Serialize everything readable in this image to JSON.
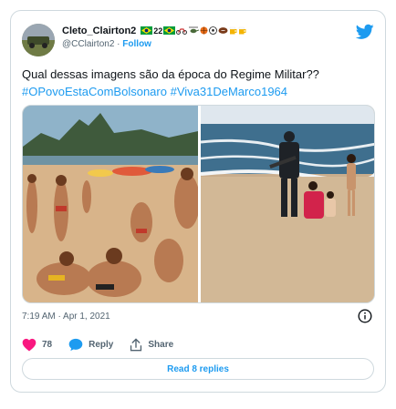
{
  "author": {
    "display_name": "Cleto_Clairton2",
    "badge_text": "22",
    "handle": "@CClairton2",
    "separator": " · ",
    "follow_label": "Follow"
  },
  "tweet": {
    "text": "Qual dessas imagens são da época do Regime Militar??",
    "hashtags": [
      "#OPovoEstaComBolsonaro",
      "#Viva31DeMarco1964"
    ]
  },
  "meta": {
    "timestamp": "7:19 AM · Apr 1, 2021"
  },
  "actions": {
    "like_count": "78",
    "reply_label": "Reply",
    "share_label": "Share"
  },
  "replies_button": "Read 8 replies",
  "icons": {
    "logo": "twitter-bird-icon",
    "like": "heart-icon",
    "reply": "speech-bubble-icon",
    "share": "share-arrow-icon",
    "info": "info-icon"
  },
  "colors": {
    "accent": "#1d9bf0",
    "like": "#f91880",
    "muted": "#536471",
    "border": "#cfd9de"
  }
}
